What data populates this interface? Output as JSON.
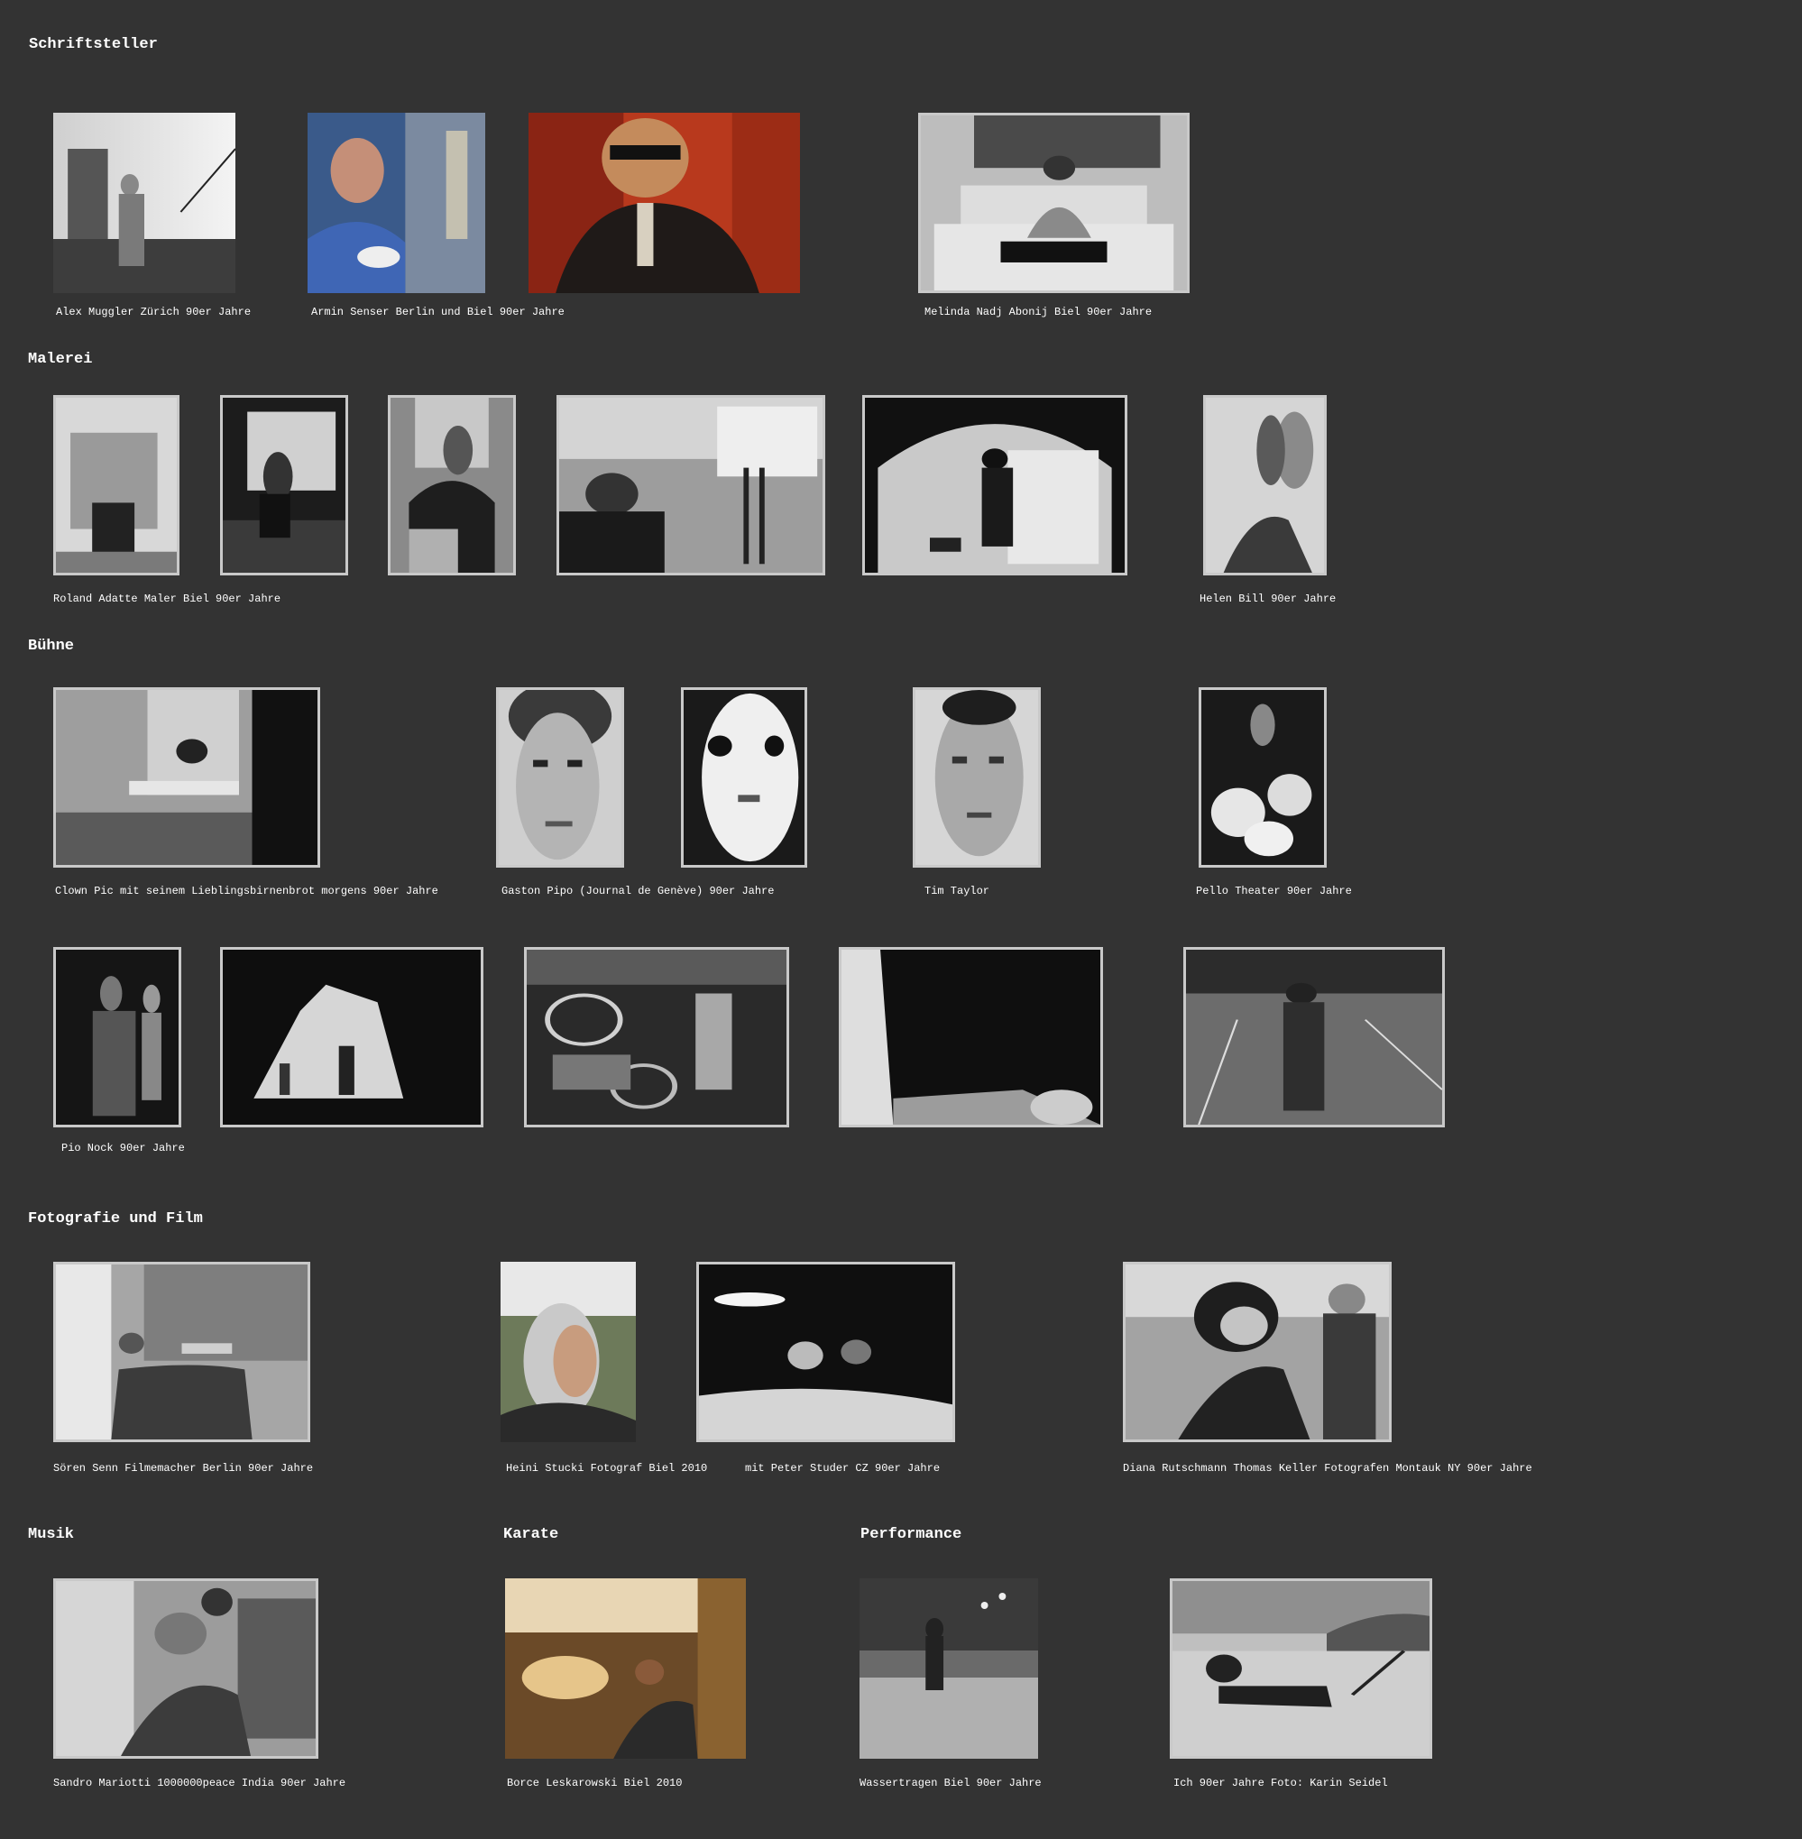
{
  "sections": {
    "schriftsteller": "Schriftsteller",
    "malerei": "Malerei",
    "buehne": "Bühne",
    "fotografie": "Fotografie und Film",
    "musik": "Musik",
    "karate": "Karate",
    "performance": "Performance"
  },
  "captions": {
    "muggler": "Alex Muggler Zürich 90er Jahre",
    "senser": "Armin Senser Berlin und Biel 90er Jahre",
    "nadj": "Melinda Nadj Abonij Biel 90er Jahre",
    "adatte": "Roland Adatte Maler Biel 90er Jahre",
    "bill": "Helen Bill 90er Jahre",
    "pic": "Clown Pic mit seinem Lieblingsbirnenbrot morgens 90er Jahre",
    "pipo": "Gaston Pipo (Journal de Genève) 90er Jahre",
    "taylor": "Tim Taylor",
    "pello": "Pello Theater 90er Jahre",
    "nock": "Pio Nock 90er Jahre",
    "senn": "Sören Senn Filmemacher Berlin 90er Jahre",
    "stucki": "Heini Stucki Fotograf Biel 2010",
    "studer": "mit Peter Studer CZ 90er Jahre",
    "rutschmann": "Diana Rutschmann Thomas Keller Fotografen Montauk NY 90er Jahre",
    "mariotti": "Sandro Mariotti 1000000peace India 90er Jahre",
    "leskarowski": "Borce Leskarowski Biel 2010",
    "wassertragen": "Wassertragen Biel 90er Jahre",
    "ich": "Ich 90er Jahre Foto: Karin Seidel"
  }
}
